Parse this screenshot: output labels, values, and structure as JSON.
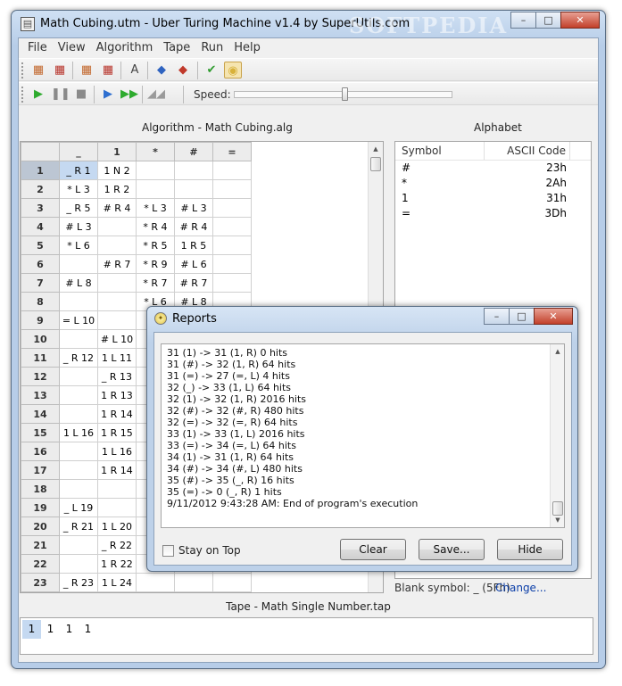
{
  "window": {
    "title": "Math Cubing.utm - Uber Turing Machine v1.4 by SuperUtils.com",
    "watermark": "SOFTPEDIA"
  },
  "caption_buttons": {
    "minimize": "–",
    "maximize": "□",
    "close": "✕"
  },
  "menu": [
    "File",
    "View",
    "Algorithm",
    "Tape",
    "Run",
    "Help"
  ],
  "toolbar": {
    "row1": [
      {
        "name": "new-algorithm-icon",
        "glyph": "▦",
        "color": "#c2672c"
      },
      {
        "name": "delete-algorithm-icon",
        "glyph": "▦",
        "color": "#b8342b"
      },
      {
        "name": "add-column-icon",
        "glyph": "▦",
        "color": "#c2672c"
      },
      {
        "name": "delete-column-icon",
        "glyph": "▦",
        "color": "#b8342b"
      },
      {
        "name": "font-icon",
        "glyph": "A",
        "color": "#444444"
      },
      {
        "name": "insert-row-icon",
        "glyph": "◆",
        "color": "#2f63c0"
      },
      {
        "name": "delete-row-icon",
        "glyph": "◆",
        "color": "#c0392b"
      },
      {
        "name": "validate-icon",
        "glyph": "✔",
        "color": "#2e9b2e"
      },
      {
        "name": "report-icon",
        "glyph": "◉",
        "color": "#d8b13a"
      }
    ],
    "row2": [
      {
        "name": "run-icon",
        "glyph": "▶",
        "color": "#2eab2e"
      },
      {
        "name": "pause-icon",
        "glyph": "❚❚",
        "color": "#8a8a8a"
      },
      {
        "name": "stop-icon",
        "glyph": "■",
        "color": "#8a8a8a"
      },
      {
        "name": "step-icon",
        "glyph": "▶",
        "color": "#2f6fd0"
      },
      {
        "name": "fast-forward-icon",
        "glyph": "▶▶",
        "color": "#2eab2e"
      },
      {
        "name": "breakpoint-icon",
        "glyph": "◢◢",
        "color": "#9a9a9a"
      }
    ],
    "speed_label": "Speed:",
    "speed_value": 0.5
  },
  "algorithm": {
    "title": "Algorithm - Math Cubing.alg",
    "columns": [
      "_",
      "1",
      "*",
      "#",
      "="
    ],
    "selected_row": 0,
    "selected_col": 0,
    "rows": [
      {
        "n": "1",
        "cells": [
          "_ R 1",
          "1 N 2",
          "",
          "",
          ""
        ]
      },
      {
        "n": "2",
        "cells": [
          "* L 3",
          "1 R 2",
          "",
          "",
          ""
        ]
      },
      {
        "n": "3",
        "cells": [
          "_ R 5",
          "# R 4",
          "* L 3",
          "# L 3",
          ""
        ]
      },
      {
        "n": "4",
        "cells": [
          "# L 3",
          "",
          "* R 4",
          "# R 4",
          ""
        ]
      },
      {
        "n": "5",
        "cells": [
          "* L 6",
          "",
          "* R 5",
          "1 R 5",
          ""
        ]
      },
      {
        "n": "6",
        "cells": [
          "",
          "# R 7",
          "* R 9",
          "# L 6",
          ""
        ]
      },
      {
        "n": "7",
        "cells": [
          "# L 8",
          "",
          "* R 7",
          "# R 7",
          ""
        ]
      },
      {
        "n": "8",
        "cells": [
          "",
          "",
          "* L 6",
          "# L 8",
          ""
        ]
      },
      {
        "n": "9",
        "cells": [
          "= L 10",
          "",
          "",
          "",
          ""
        ]
      },
      {
        "n": "10",
        "cells": [
          "",
          "# L 10",
          "",
          "",
          ""
        ]
      },
      {
        "n": "11",
        "cells": [
          "_ R 12",
          "1 L 11",
          "",
          "",
          ""
        ]
      },
      {
        "n": "12",
        "cells": [
          "",
          "_ R 13",
          "",
          "",
          ""
        ]
      },
      {
        "n": "13",
        "cells": [
          "",
          "1 R 13",
          "",
          "",
          ""
        ]
      },
      {
        "n": "14",
        "cells": [
          "",
          "1 R 14",
          "",
          "",
          ""
        ]
      },
      {
        "n": "15",
        "cells": [
          "1 L 16",
          "1 R 15",
          "",
          "",
          ""
        ]
      },
      {
        "n": "16",
        "cells": [
          "",
          "1 L 16",
          "",
          "",
          ""
        ]
      },
      {
        "n": "17",
        "cells": [
          "",
          "1 R 14",
          "",
          "",
          ""
        ]
      },
      {
        "n": "18",
        "cells": [
          "",
          "",
          "",
          "",
          ""
        ]
      },
      {
        "n": "19",
        "cells": [
          "_ L 19",
          "",
          "",
          "",
          ""
        ]
      },
      {
        "n": "20",
        "cells": [
          "_ R 21",
          "1 L 20",
          "",
          "",
          ""
        ]
      },
      {
        "n": "21",
        "cells": [
          "",
          "_ R 22",
          "",
          "",
          ""
        ]
      },
      {
        "n": "22",
        "cells": [
          "",
          "1 R 22",
          "",
          "",
          ""
        ]
      },
      {
        "n": "23",
        "cells": [
          "_ R 23",
          "1 L 24",
          "",
          "",
          ""
        ]
      }
    ]
  },
  "alphabet": {
    "title": "Alphabet",
    "headers": [
      "Symbol",
      "ASCII Code"
    ],
    "rows": [
      {
        "symbol": "#",
        "code": "23h"
      },
      {
        "symbol": "*",
        "code": "2Ah"
      },
      {
        "symbol": "1",
        "code": "31h"
      },
      {
        "symbol": "=",
        "code": "3Dh"
      }
    ],
    "blank_symbol": "Blank symbol: _ (5Fh)",
    "change_link": "Change..."
  },
  "tape": {
    "title": "Tape - Math Single Number.tap",
    "cells": [
      "1",
      "1",
      "1",
      "1"
    ],
    "head": 0
  },
  "reports": {
    "title": "Reports",
    "lines": [
      "31 (1) -> 31 (1, R)   0 hits",
      "31 (#) -> 32 (1, R)   64 hits",
      "31 (=) -> 27 (=, L)   4 hits",
      "32 (_) -> 33 (1, L)   64 hits",
      "32 (1) -> 32 (1, R)   2016 hits",
      "32 (#) -> 32 (#, R)   480 hits",
      "32 (=) -> 32 (=, R)   64 hits",
      "33 (1) -> 33 (1, L)   2016 hits",
      "33 (=) -> 34 (=, L)   64 hits",
      "34 (1) -> 31 (1, R)   64 hits",
      "34 (#) -> 34 (#, L)   480 hits",
      "35 (#) -> 35 (_, R)   16 hits",
      "35 (=) -> 0 (_, R)   1 hits",
      "9/11/2012 9:43:28 AM: End of program's execution"
    ],
    "stay_on_top": "Stay on Top",
    "clear": "Clear",
    "save": "Save...",
    "hide": "Hide"
  }
}
